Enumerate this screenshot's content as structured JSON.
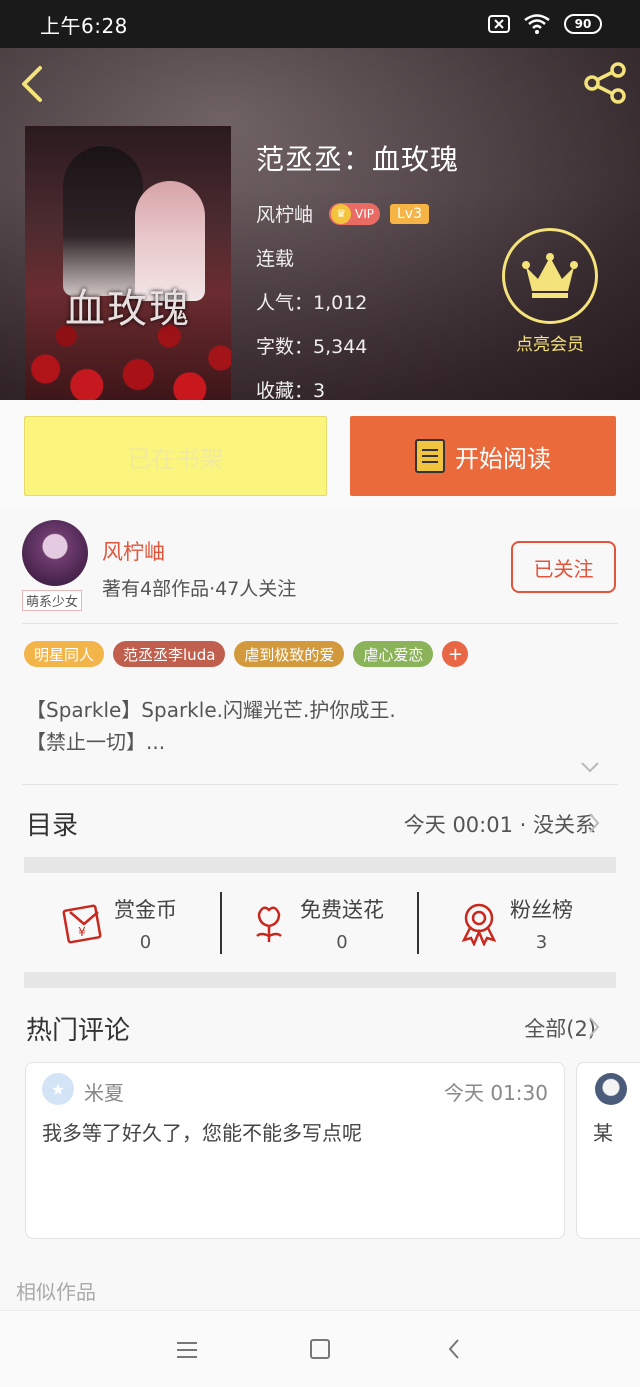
{
  "status_bar": {
    "time": "上午6:28",
    "battery": "90"
  },
  "book": {
    "title": "范丞丞：血玫瑰",
    "author": "风柠岫",
    "vip_label": "VIP",
    "level": "Lv3",
    "status": "连载",
    "popularity": "人气：1,012",
    "word_count": "字数：5,344",
    "favorites": "收藏：3",
    "cover_title": "血玫瑰"
  },
  "member": {
    "label": "点亮会员"
  },
  "actions": {
    "shelf_label": "已在书架",
    "read_label": "开始阅读"
  },
  "author_info": {
    "name": "风柠岫",
    "stats": "著有4部作品·47人关注",
    "tag": "萌系少女",
    "follow_label": "已关注"
  },
  "tags": [
    {
      "label": "明星同人",
      "color": "#f3b449"
    },
    {
      "label": "范丞丞李luda",
      "color": "#c05f4e"
    },
    {
      "label": "虐到极致的爱",
      "color": "#d29a3c"
    },
    {
      "label": "虐心爱恋",
      "color": "#8ab35a"
    }
  ],
  "tag_more": "+",
  "description": {
    "line1": "【Sparkle】Sparkle.闪耀光芒.护你成王.",
    "line2": "【禁止一切】..."
  },
  "catalog": {
    "title": "目录",
    "latest": "今天 00:01 · 没关系"
  },
  "stats": [
    {
      "label": "赏金币",
      "value": "0"
    },
    {
      "label": "免费送花",
      "value": "0"
    },
    {
      "label": "粉丝榜",
      "value": "3"
    }
  ],
  "comments": {
    "title": "热门评论",
    "all_label": "全部(2)",
    "items": [
      {
        "user": "米夏",
        "time": "今天 01:30",
        "text": "我多等了好久了，您能不能多写点呢"
      },
      {
        "text": "某"
      }
    ]
  },
  "similar_title": "相似作品",
  "colors": {
    "accent": "#ea6a3c",
    "shelf": "#fbf57e",
    "member": "#f4e27a",
    "link": "#e0553c"
  }
}
